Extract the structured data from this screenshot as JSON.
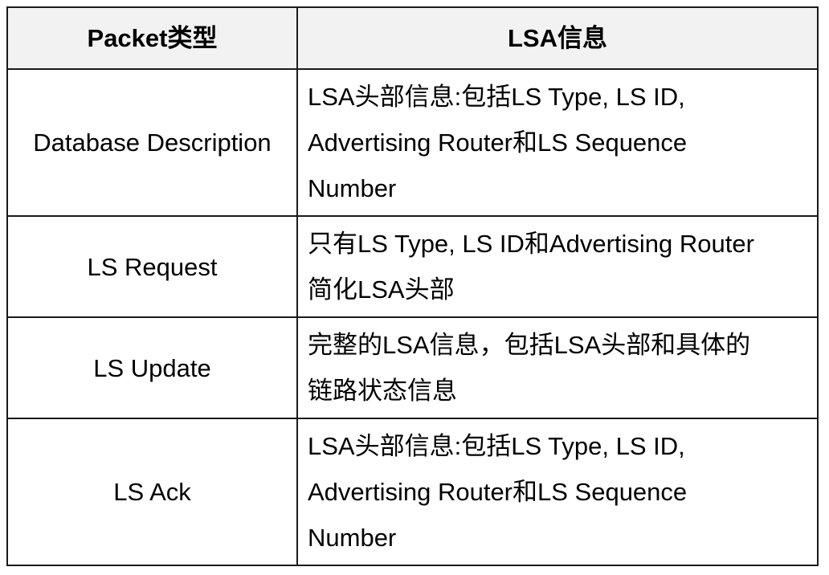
{
  "table": {
    "headers": {
      "packet_type": "Packet类型",
      "lsa_info": "LSA信息"
    },
    "rows": [
      {
        "packet_type": "Database Description",
        "lsa_info_lines": [
          "LSA头部信息:包括LS Type, LS ID,",
          "Advertising Router和LS Sequence",
          "Number"
        ]
      },
      {
        "packet_type": "LS Request",
        "lsa_info_lines": [
          "只有LS Type, LS ID和Advertising Router",
          "简化LSA头部"
        ]
      },
      {
        "packet_type": "LS Update",
        "lsa_info_lines": [
          "完整的LSA信息，包括LSA头部和具体的",
          "链路状态信息"
        ]
      },
      {
        "packet_type": "LS Ack",
        "lsa_info_lines": [
          "LSA头部信息:包括LS Type, LS ID,",
          "Advertising Router和LS Sequence",
          "Number"
        ]
      }
    ]
  }
}
